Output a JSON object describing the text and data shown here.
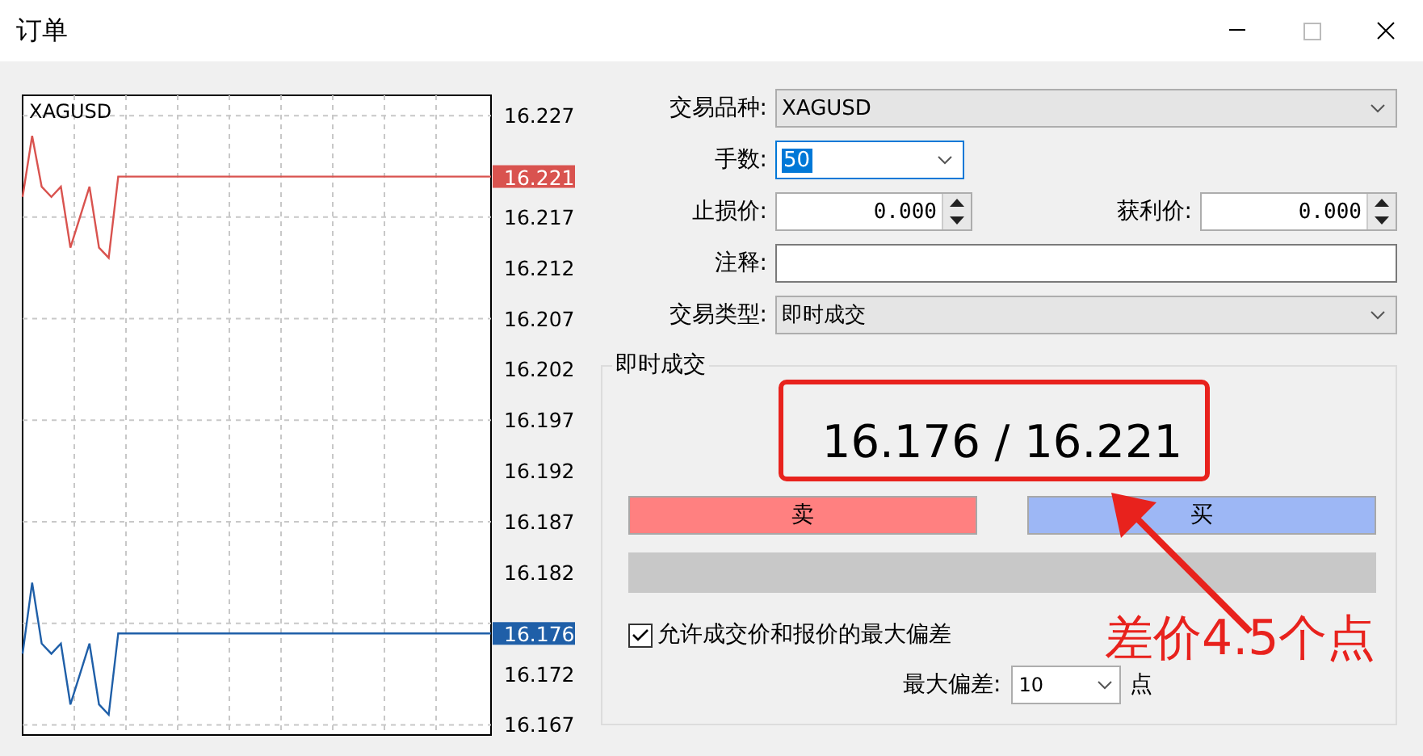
{
  "window": {
    "title": "订单"
  },
  "chart": {
    "symbol": "XAGUSD",
    "ask_tag": "16.221",
    "bid_tag": "16.176",
    "chart_data": {
      "type": "line",
      "grid": true,
      "categories": [
        null,
        null,
        null,
        null,
        null,
        null,
        null,
        null,
        null,
        null,
        null,
        null,
        null,
        null,
        null,
        null,
        null,
        null,
        null,
        null,
        null,
        null,
        null,
        null,
        null,
        null,
        null,
        null,
        null,
        null,
        null,
        null,
        null,
        null,
        null,
        null,
        null,
        null,
        null,
        null,
        null,
        null,
        null,
        null,
        null,
        null,
        null,
        null,
        null,
        null
      ],
      "ylim": [
        16.166,
        16.229
      ],
      "yticks": [
        16.227,
        16.217,
        16.212,
        16.207,
        16.202,
        16.197,
        16.192,
        16.187,
        16.182,
        16.172,
        16.167
      ],
      "series": [
        {
          "color": "#d9534f",
          "values": [
            16.219,
            16.225,
            16.22,
            16.219,
            16.22,
            16.214,
            16.217,
            16.22,
            16.214,
            16.213,
            16.221,
            16.221,
            16.221,
            16.221,
            16.221,
            16.221,
            16.221,
            16.221,
            16.221,
            16.221,
            16.221,
            16.221,
            16.221,
            16.221,
            16.221,
            16.221,
            16.221,
            16.221,
            16.221,
            16.221,
            16.221,
            16.221,
            16.221,
            16.221,
            16.221,
            16.221,
            16.221,
            16.221,
            16.221,
            16.221,
            16.221,
            16.221,
            16.221,
            16.221,
            16.221,
            16.221,
            16.221,
            16.221,
            16.221,
            16.221
          ]
        },
        {
          "color": "#1f5fa8",
          "values": [
            16.174,
            16.181,
            16.175,
            16.174,
            16.175,
            16.169,
            16.172,
            16.175,
            16.169,
            16.168,
            16.176,
            16.176,
            16.176,
            16.176,
            16.176,
            16.176,
            16.176,
            16.176,
            16.176,
            16.176,
            16.176,
            16.176,
            16.176,
            16.176,
            16.176,
            16.176,
            16.176,
            16.176,
            16.176,
            16.176,
            16.176,
            16.176,
            16.176,
            16.176,
            16.176,
            16.176,
            16.176,
            16.176,
            16.176,
            16.176,
            16.176,
            16.176,
            16.176,
            16.176,
            16.176,
            16.176,
            16.176,
            16.176,
            16.176,
            16.176
          ]
        }
      ]
    }
  },
  "form": {
    "symbol": {
      "label": "交易品种:",
      "value": "XAGUSD"
    },
    "volume": {
      "label": "手数:",
      "value": "50",
      "highlighted": true
    },
    "stop_loss": {
      "label": "止损价:",
      "value": "0.000"
    },
    "take_profit": {
      "label": "获利价:",
      "value": "0.000"
    },
    "comment": {
      "label": "注释:"
    },
    "order_type": {
      "label": "交易类型:",
      "value": "即时成交"
    }
  },
  "execution": {
    "title": "即时成交",
    "price": "16.176 / 16.221",
    "sell": "卖",
    "buy": "买",
    "deviation_check": {
      "label": "允许成交价和报价的最大偏差",
      "checked": true
    },
    "max_deviation": {
      "label": "最大偏差:",
      "value": "10",
      "unit": "点"
    }
  },
  "annotation": {
    "text": "差价4.5个点"
  }
}
